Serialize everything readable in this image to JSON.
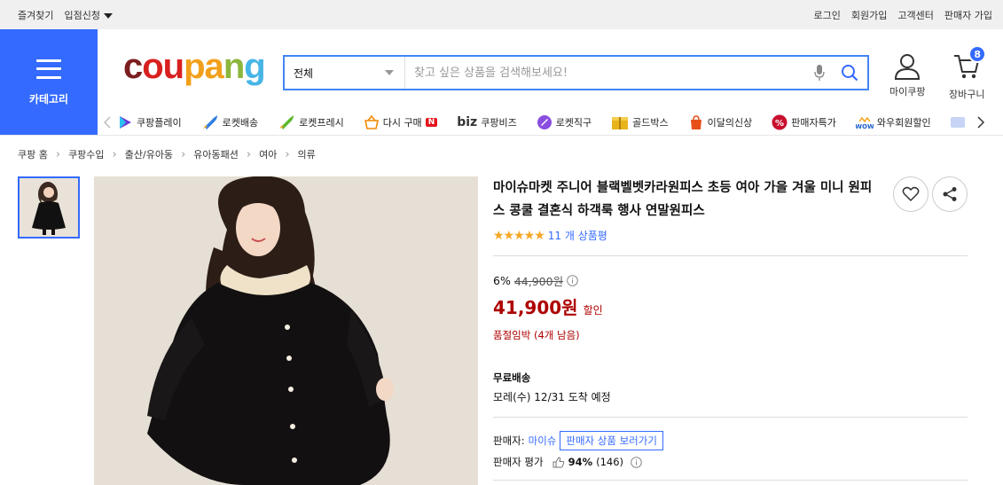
{
  "topbar": {
    "bookmark": "즐겨찾기",
    "seller_apply": "입점신청",
    "login": "로그인",
    "signup": "회원가입",
    "customer_center": "고객센터",
    "seller_signup": "판매자 가입"
  },
  "header": {
    "category_label": "카테고리",
    "logo": [
      "c",
      "ou",
      "pa",
      "n",
      "g"
    ],
    "search": {
      "category": "전체",
      "placeholder": "찾고 싶은 상품을 검색해보세요!"
    },
    "my_coupang": "마이쿠팡",
    "cart": "장바구니",
    "cart_count": "8"
  },
  "nav": {
    "items": [
      {
        "label": "쿠팡플레이",
        "icon": "coupang-play-icon",
        "color": "#6a3bd6"
      },
      {
        "label": "로켓배송",
        "icon": "rocket-icon",
        "color": "#2f7de1"
      },
      {
        "label": "로켓프레시",
        "icon": "rocket-fresh-icon",
        "color": "#5cb82e"
      },
      {
        "label": "다시 구매",
        "icon": "basket-icon",
        "color": "#f08a00",
        "badge": "N"
      },
      {
        "label": "쿠팡비즈",
        "icon": "biz-icon",
        "color": "#333333",
        "prefix": "biz"
      },
      {
        "label": "로켓직구",
        "icon": "rocket-direct-icon",
        "color": "#8b4de0"
      },
      {
        "label": "골드박스",
        "icon": "goldbox-icon",
        "color": "#e8b31b"
      },
      {
        "label": "이달의신상",
        "icon": "new-product-icon",
        "color": "#e8501a"
      },
      {
        "label": "판매자특가",
        "icon": "percent-icon",
        "color": "#c8102e"
      },
      {
        "label": "와우회원할인",
        "icon": "wow-icon",
        "color": "#1b5ec9"
      }
    ]
  },
  "breadcrumb": [
    "쿠팡 홈",
    "쿠팡수입",
    "출산/유아동",
    "유아동패션",
    "여아",
    "의류"
  ],
  "product": {
    "title": "마이슈마켓 주니어 블랙벨벳카라원피스 초등 여아 가을 겨울 미니 원피스 콩쿨 결혼식 하객룩 행사 연말원피스",
    "review_count": "11 개 상품평",
    "discount": "6%",
    "original_price": "44,900원",
    "sale_price": "41,900원",
    "sale_tag": "할인",
    "stock_notice": "품절임박 (4개 남음)",
    "shipping_title": "무료배송",
    "delivery": "모레(수) 12/31 도착 예정",
    "seller_label": "판매자:",
    "seller_name": "마이슈",
    "seller_button": "판매자 상품 보러가기",
    "seller_rating_label": "판매자 평가",
    "seller_rating": "94%",
    "seller_rating_count": "(146)"
  },
  "colors": {
    "brand": "#346aff",
    "price": "#ae0000",
    "star": "#f5a623"
  }
}
